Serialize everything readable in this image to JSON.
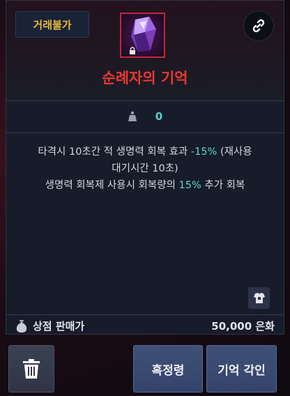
{
  "item": {
    "trade_status": "거래불가",
    "name": "순례자의 기억",
    "stat_value": "0",
    "description_line1_a": "타격시 10초간 적 생명력 회복 효과 ",
    "description_line1_hl": "-15%",
    "description_line1_b": " (재사용",
    "description_line2": "대기시간 10초)",
    "description_line3_a": "생명력 회복제 사용시 회복량의 ",
    "description_line3_hl": "15%",
    "description_line3_b": " 추가 회복"
  },
  "shop": {
    "label": "상점 판매가",
    "value": "50,000 은화"
  },
  "buttons": {
    "enhance": "흑정령",
    "engrave": "기억 각인"
  },
  "icons": {
    "link": "link-icon",
    "weight": "weight-icon",
    "armor": "armor-icon",
    "silver": "silver-bag-icon",
    "trash": "trash-icon",
    "lock": "lock-icon"
  },
  "colors": {
    "name": "#e7392e",
    "trade": "#e6b73a",
    "highlight": "#5fd6c6",
    "icon_border": "#c2263a"
  }
}
